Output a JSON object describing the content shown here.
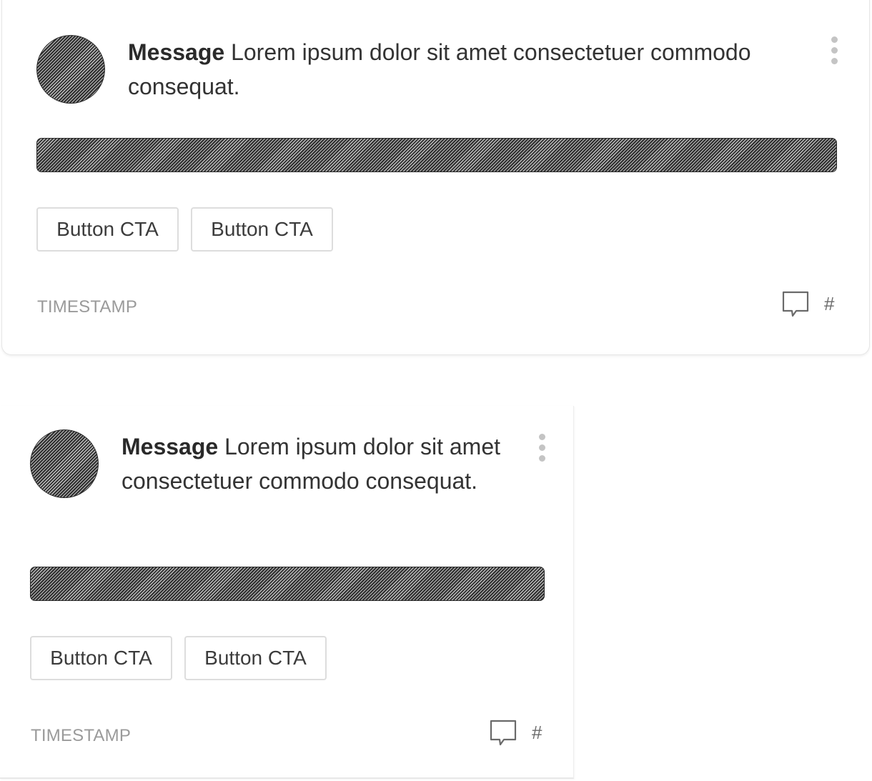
{
  "cards": [
    {
      "message_bold": "Message",
      "message_text": " Lorem ipsum dolor sit amet consectetuer commodo consequat.",
      "buttons": [
        "Button CTA",
        "Button CTA"
      ],
      "timestamp": "TIMESTAMP",
      "comment_count": "#"
    },
    {
      "message_bold": "Message",
      "message_text": " Lorem ipsum dolor sit amet consectetuer commodo consequat.",
      "buttons": [
        "Button CTA",
        "Button CTA"
      ],
      "timestamp": "TIMESTAMP",
      "comment_count": "#"
    }
  ],
  "icons": {
    "avatar": "avatar-placeholder",
    "menu": "more-vertical-icon",
    "comment": "comment-bubble-icon"
  },
  "colors": {
    "placeholder_fill": "#3a3a3a",
    "border": "#dddddd",
    "muted_text": "#9a9a9a"
  }
}
